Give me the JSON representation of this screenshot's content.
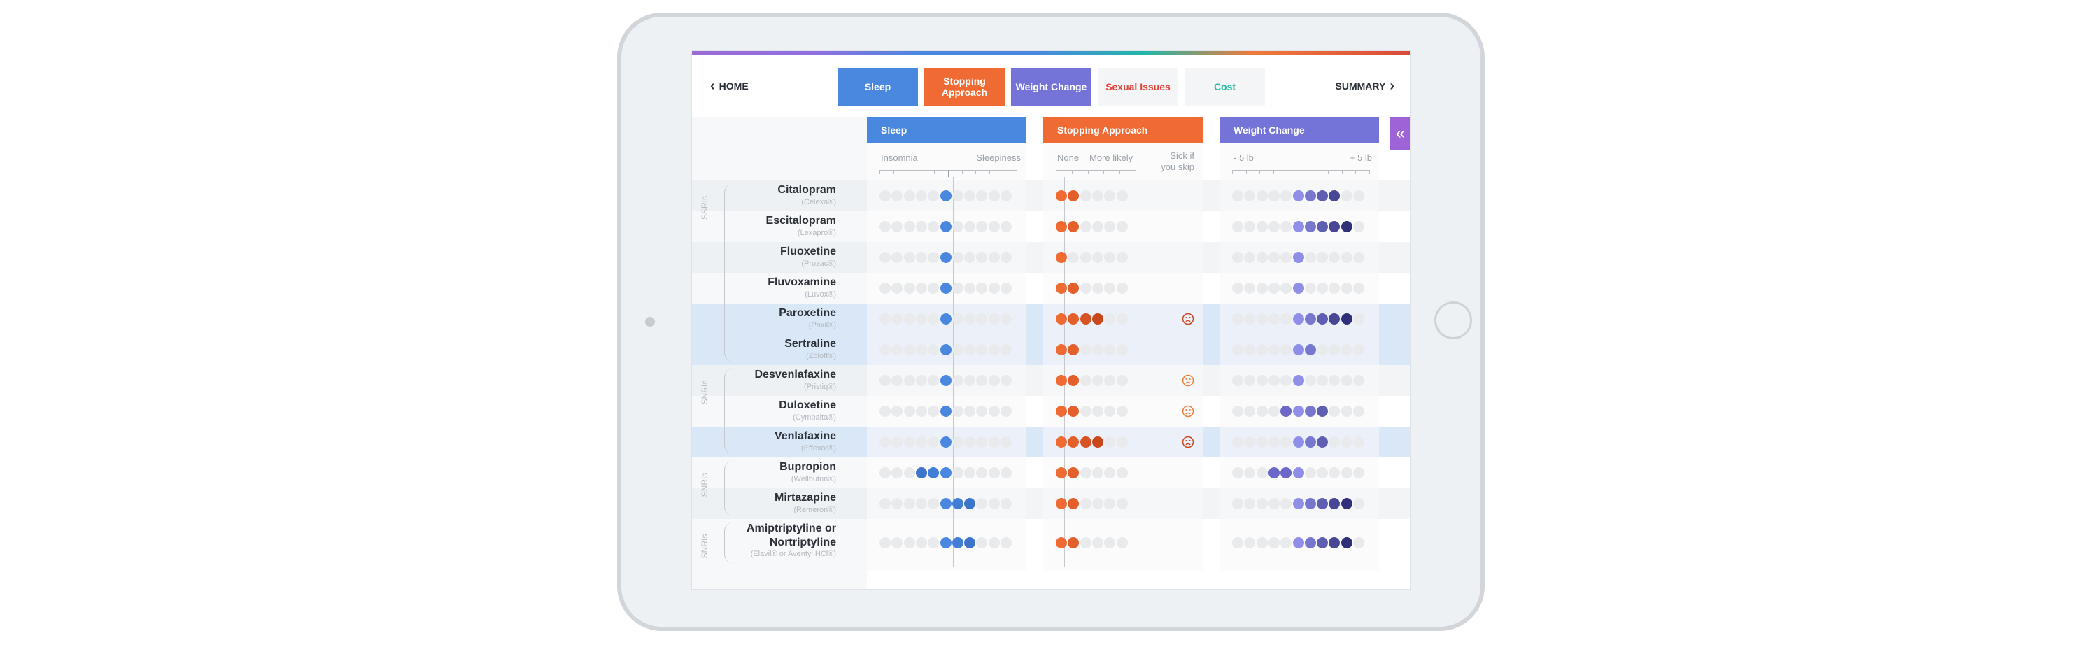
{
  "header": {
    "home_label": "HOME",
    "summary_label": "SUMMARY",
    "tabs": [
      {
        "label": "Sleep",
        "bg": "#4a88e0",
        "fg": "#ffffff"
      },
      {
        "label": "Stopping Approach",
        "bg": "#f06b34",
        "fg": "#ffffff"
      },
      {
        "label": "Weight Change",
        "bg": "#7474d8",
        "fg": "#ffffff"
      },
      {
        "label": "Sexual Issues",
        "bg": "#f4f5f6",
        "fg": "#e0453a"
      },
      {
        "label": "Cost",
        "bg": "#f4f5f6",
        "fg": "#2bb5a5"
      }
    ]
  },
  "columns": {
    "sleep": {
      "title": "Sleep",
      "color": "#4a88e0",
      "low_label": "Insomnia",
      "high_label": "Sleepiness"
    },
    "stopping": {
      "title": "Stopping Approach",
      "color": "#f06b34",
      "low_label": "None",
      "high_label": "More likely",
      "skip_label": "Sick if you skip"
    },
    "weight": {
      "title": "Weight Change",
      "color": "#7474d8",
      "low_label": "- 5 lb",
      "high_label": "+ 5 lb"
    },
    "collapse_icon": "double-chevron-left-icon"
  },
  "groups": [
    {
      "label": "SSRIs",
      "first_row": 0,
      "last_row": 5
    },
    {
      "label": "SNRIs",
      "first_row": 6,
      "last_row": 8
    },
    {
      "label": "SNRIs",
      "first_row": 9,
      "last_row": 10
    },
    {
      "label": "SNRIs",
      "first_row": 11,
      "last_row": 11
    }
  ],
  "drugs": [
    {
      "name": "Citalopram",
      "brand": "(Celexa®)",
      "highlight": false,
      "sleep": [
        0
      ],
      "stopping": 2,
      "sick_if_skip": false,
      "weight": [
        0,
        1,
        2,
        3
      ]
    },
    {
      "name": "Escitalopram",
      "brand": "(Lexapro®)",
      "highlight": false,
      "sleep": [
        0
      ],
      "stopping": 2,
      "sick_if_skip": false,
      "weight": [
        0,
        1,
        2,
        3,
        4
      ]
    },
    {
      "name": "Fluoxetine",
      "brand": "(Prozac®)",
      "highlight": false,
      "sleep": [
        0
      ],
      "stopping": 1,
      "sick_if_skip": false,
      "weight": [
        0
      ]
    },
    {
      "name": "Fluvoxamine",
      "brand": "(Luvox®)",
      "highlight": false,
      "sleep": [
        0
      ],
      "stopping": 2,
      "sick_if_skip": false,
      "weight": [
        0
      ]
    },
    {
      "name": "Paroxetine",
      "brand": "(Paxil®)",
      "highlight": true,
      "sleep": [
        0
      ],
      "stopping": 4,
      "sick_if_skip": true,
      "weight": [
        0,
        1,
        2,
        3,
        4
      ]
    },
    {
      "name": "Sertraline",
      "brand": "(Zoloft®)",
      "highlight": true,
      "sleep": [
        0
      ],
      "stopping": 2,
      "sick_if_skip": false,
      "weight": [
        0,
        1
      ]
    },
    {
      "name": "Desvenlafaxine",
      "brand": "(Pristiq®)",
      "highlight": false,
      "sleep": [
        0
      ],
      "stopping": 2,
      "sick_if_skip": true,
      "weight": [
        0
      ]
    },
    {
      "name": "Duloxetine",
      "brand": "(Cymbalta®)",
      "highlight": false,
      "sleep": [
        0
      ],
      "stopping": 2,
      "sick_if_skip": true,
      "weight": [
        -1,
        0,
        1,
        2
      ]
    },
    {
      "name": "Venlafaxine",
      "brand": "(Effexor®)",
      "highlight": true,
      "sleep": [
        0
      ],
      "stopping": 4,
      "sick_if_skip": true,
      "weight": [
        0,
        1,
        2
      ]
    },
    {
      "name": "Bupropion",
      "brand": "(Wellbutrin®)",
      "highlight": false,
      "sleep": [
        -2,
        -1,
        0
      ],
      "stopping": 2,
      "sick_if_skip": false,
      "weight": [
        -2,
        -1,
        0
      ]
    },
    {
      "name": "Mirtazapine",
      "brand": "(Remeron®)",
      "highlight": false,
      "sleep": [
        0,
        1,
        2
      ],
      "stopping": 2,
      "sick_if_skip": false,
      "weight": [
        0,
        1,
        2,
        3,
        4
      ]
    },
    {
      "name": "Amiptriptyline or Nortriptyline",
      "brand": "(Elavil® or Aventyl HCl®)",
      "highlight": false,
      "sleep": [
        0,
        1,
        2
      ],
      "stopping": 2,
      "sick_if_skip": false,
      "weight": [
        0,
        1,
        2,
        3,
        4
      ]
    }
  ]
}
